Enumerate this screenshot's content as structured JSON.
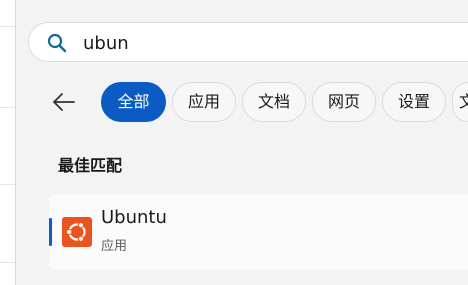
{
  "search": {
    "query": "ubun"
  },
  "filters": [
    {
      "label": "全部",
      "active": true
    },
    {
      "label": "应用",
      "active": false
    },
    {
      "label": "文档",
      "active": false
    },
    {
      "label": "网页",
      "active": false
    },
    {
      "label": "设置",
      "active": false
    },
    {
      "label": "文件夹",
      "active": false
    }
  ],
  "best_match": {
    "title": "最佳匹配",
    "result": {
      "name": "Ubuntu",
      "type": "应用",
      "icon": "ubuntu-icon"
    }
  },
  "colors": {
    "accent": "#0a5bc4",
    "ubuntu_orange": "#e95420",
    "search_icon": "#0f6b9c"
  }
}
